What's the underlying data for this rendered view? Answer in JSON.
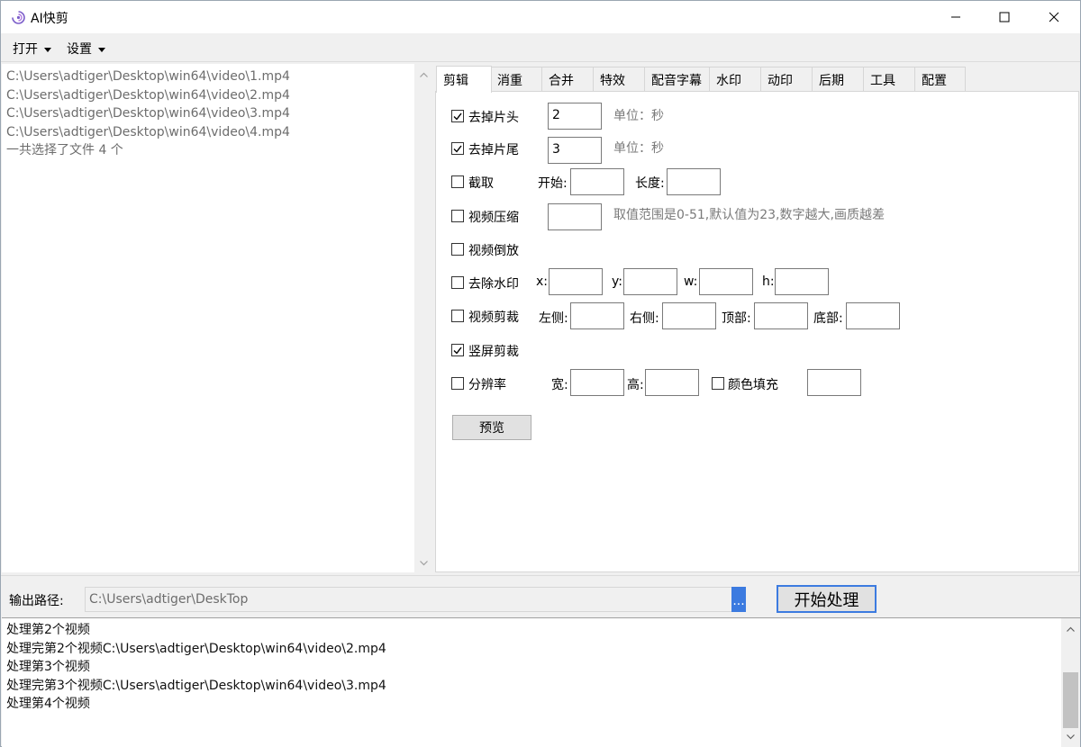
{
  "window": {
    "title": "AI快剪"
  },
  "menu": {
    "open": "打开",
    "settings": "设置"
  },
  "file_list": {
    "lines": [
      "C:\\Users\\adtiger\\Desktop\\win64\\video\\1.mp4",
      "C:\\Users\\adtiger\\Desktop\\win64\\video\\2.mp4",
      "C:\\Users\\adtiger\\Desktop\\win64\\video\\3.mp4",
      "C:\\Users\\adtiger\\Desktop\\win64\\video\\4.mp4",
      "一共选择了文件 4 个"
    ]
  },
  "tabs": [
    "剪辑",
    "消重",
    "合并",
    "特效",
    "配音字幕",
    "水印",
    "动印",
    "后期",
    "工具",
    "配置"
  ],
  "edit": {
    "trim_head": {
      "label": "去掉片头",
      "checked": true,
      "value": "2",
      "unit": "单位：秒"
    },
    "trim_tail": {
      "label": "去掉片尾",
      "checked": true,
      "value": "3",
      "unit": "单位：秒"
    },
    "cut": {
      "label": "截取",
      "checked": false,
      "start_label": "开始:",
      "length_label": "长度:"
    },
    "compress": {
      "label": "视频压缩",
      "checked": false,
      "hint": "取值范围是0-51,默认值为23,数字越大,画质越差"
    },
    "reverse": {
      "label": "视频倒放",
      "checked": false
    },
    "remove_watermark": {
      "label": "去除水印",
      "checked": false,
      "x_label": "x:",
      "y_label": "y:",
      "w_label": "w:",
      "h_label": "h:"
    },
    "crop": {
      "label": "视频剪裁",
      "checked": false,
      "left_label": "左侧:",
      "right_label": "右侧:",
      "top_label": "顶部:",
      "bottom_label": "底部:"
    },
    "vertical_crop": {
      "label": "竖屏剪裁",
      "checked": true
    },
    "resolution": {
      "label": "分辨率",
      "checked": false,
      "width_label": "宽:",
      "height_label": "高:",
      "fill_label": "颜色填充",
      "fill_checked": false
    },
    "preview_button": "预览"
  },
  "output": {
    "label": "输出路径:",
    "path": "C:\\Users\\adtiger\\DeskTop",
    "browse": "...",
    "start_button": "开始处理"
  },
  "log": {
    "lines": [
      "处理第2个视频",
      "处理完第2个视频C:\\Users\\adtiger\\Desktop\\win64\\video\\2.mp4",
      "处理第3个视频",
      "处理完第3个视频C:\\Users\\adtiger\\Desktop\\win64\\video\\3.mp4",
      "处理第4个视频"
    ]
  },
  "colors": {
    "accent": "#3c7be0",
    "hint_text": "#7a7a7a",
    "file_text": "#6d6d6d"
  }
}
